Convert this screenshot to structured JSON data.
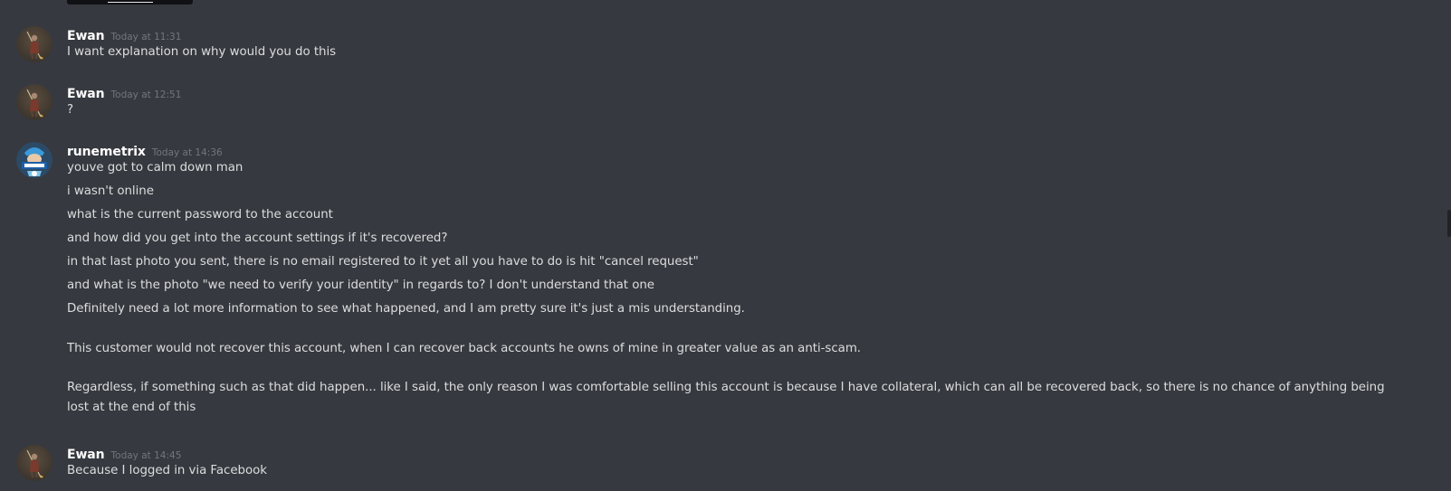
{
  "messages": [
    {
      "author": "Ewan",
      "timestamp": "Today at 11:31",
      "avatar_icon": "warrior-avatar-icon",
      "lines": [
        "I want explanation on why would you do this"
      ]
    },
    {
      "author": "Ewan",
      "timestamp": "Today at 12:51",
      "avatar_icon": "warrior-avatar-icon",
      "lines": [
        "?"
      ]
    },
    {
      "author": "runemetrix",
      "timestamp": "Today at 14:36",
      "avatar_icon": "runemetrix-logo-avatar-icon",
      "lines": [
        "youve got to calm down man",
        "i wasn't online",
        "what is the current password to the account",
        "and how did you get into the account settings if it's recovered?",
        "in that last photo you sent, there is no email registered to it yet all you have to do is hit \"cancel request\"",
        "and what is the photo \"we need to verify your identity\" in regards to? I don't understand that one",
        "Definitely need a lot more information to see what happened, and I am pretty sure it's just a mis understanding.",
        "This customer would not recover this account, when I can recover back accounts he owns of mine in greater value as an anti-scam.",
        "Regardless, if something such as that did happen... like I said, the only reason I was comfortable selling this account is because I have collateral, which can all be recovered back, so there is no chance of anything being lost at the end of this"
      ]
    },
    {
      "author": "Ewan",
      "timestamp": "Today at 14:45",
      "avatar_icon": "warrior-avatar-icon",
      "lines": [
        "Because I logged in via Facebook"
      ]
    }
  ],
  "colors": {
    "background": "#36393f",
    "author": "#ffffff",
    "text": "#dcddde",
    "timestamp": "#72767d"
  }
}
